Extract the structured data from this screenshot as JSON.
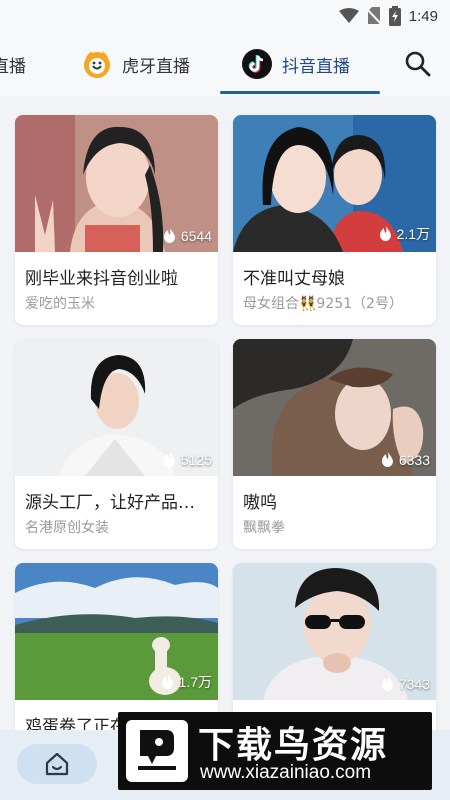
{
  "status_bar": {
    "time": "1:49"
  },
  "tabs": [
    {
      "label": "直播",
      "id": "partial"
    },
    {
      "label": "虎牙直播",
      "id": "huya"
    },
    {
      "label": "抖音直播",
      "id": "douyin",
      "active": true
    }
  ],
  "colors": {
    "accent": "#1f5f9e",
    "background": "#f1f3f6"
  },
  "cards": [
    {
      "title": "刚毕业来抖音创业啦",
      "streamer": "爱吃的玉米",
      "heat": "6544"
    },
    {
      "title": "不准叫丈母娘",
      "streamer": "母女组合👯9251（2号）",
      "heat": "2.1万"
    },
    {
      "title": "源头工厂，让好产品…",
      "streamer": "名港原创女装",
      "heat": "5125"
    },
    {
      "title": "嗷呜",
      "streamer": "飘飘拳",
      "heat": "6333"
    },
    {
      "title": "鸡蛋卷了正在",
      "streamer": "",
      "heat": "1.7万"
    },
    {
      "title": "",
      "streamer": "",
      "heat": "7343"
    }
  ],
  "watermark": {
    "title": "下载鸟资源",
    "url": "www.xiazainiao.com"
  }
}
